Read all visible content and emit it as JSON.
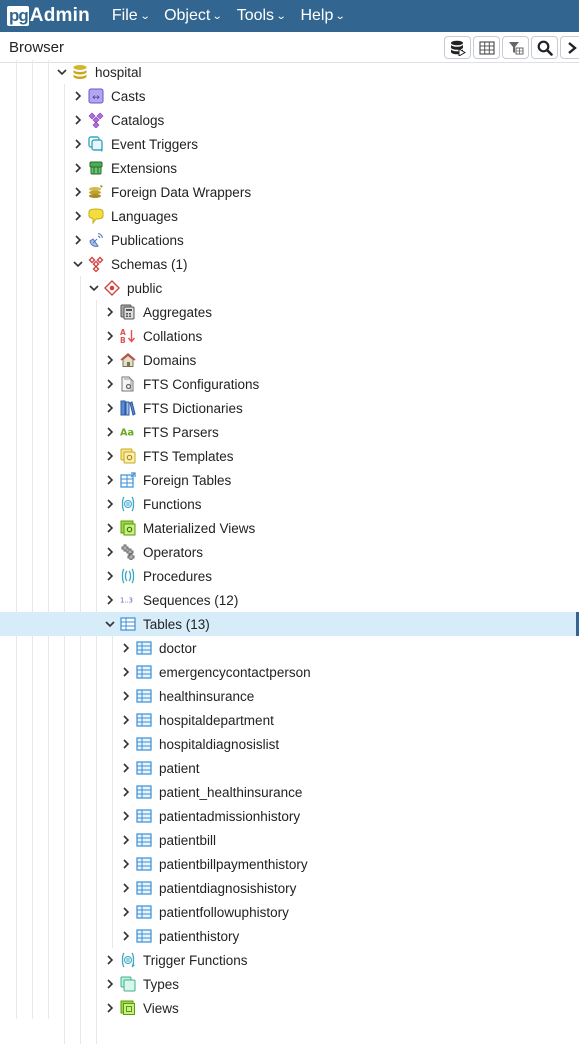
{
  "app": {
    "logo_pg": "pg",
    "logo_admin": "Admin",
    "menu": [
      {
        "label": "File"
      },
      {
        "label": "Object"
      },
      {
        "label": "Tools"
      },
      {
        "label": "Help"
      }
    ]
  },
  "browser": {
    "title": "Browser",
    "toolbar": [
      {
        "icon": "query-tool-icon"
      },
      {
        "icon": "view-data-icon"
      },
      {
        "icon": "filtered-rows-icon"
      },
      {
        "icon": "search-objects-icon"
      },
      {
        "icon": "psql-tool-icon"
      }
    ]
  },
  "tree": {
    "accent": "#326690",
    "selected_bg": "#d6ecf9",
    "rows": [
      {
        "label": "hospital",
        "level": 0,
        "expanded": true,
        "icon": "database-icon"
      },
      {
        "label": "Casts",
        "level": 1,
        "expanded": false,
        "icon": "casts-icon"
      },
      {
        "label": "Catalogs",
        "level": 1,
        "expanded": false,
        "icon": "catalogs-icon"
      },
      {
        "label": "Event Triggers",
        "level": 1,
        "expanded": false,
        "icon": "event-triggers-icon"
      },
      {
        "label": "Extensions",
        "level": 1,
        "expanded": false,
        "icon": "extensions-icon"
      },
      {
        "label": "Foreign Data Wrappers",
        "level": 1,
        "expanded": false,
        "icon": "foreign-data-wrappers-icon"
      },
      {
        "label": "Languages",
        "level": 1,
        "expanded": false,
        "icon": "languages-icon"
      },
      {
        "label": "Publications",
        "level": 1,
        "expanded": false,
        "icon": "publications-icon"
      },
      {
        "label": "Schemas (1)",
        "level": 1,
        "expanded": true,
        "icon": "schemas-icon"
      },
      {
        "label": "public",
        "level": 2,
        "expanded": true,
        "icon": "schema-icon"
      },
      {
        "label": "Aggregates",
        "level": 3,
        "expanded": false,
        "icon": "aggregates-icon"
      },
      {
        "label": "Collations",
        "level": 3,
        "expanded": false,
        "icon": "collations-icon"
      },
      {
        "label": "Domains",
        "level": 3,
        "expanded": false,
        "icon": "domains-icon"
      },
      {
        "label": "FTS Configurations",
        "level": 3,
        "expanded": false,
        "icon": "fts-configurations-icon"
      },
      {
        "label": "FTS Dictionaries",
        "level": 3,
        "expanded": false,
        "icon": "fts-dictionaries-icon"
      },
      {
        "label": "FTS Parsers",
        "level": 3,
        "expanded": false,
        "icon": "fts-parsers-icon"
      },
      {
        "label": "FTS Templates",
        "level": 3,
        "expanded": false,
        "icon": "fts-templates-icon"
      },
      {
        "label": "Foreign Tables",
        "level": 3,
        "expanded": false,
        "icon": "foreign-tables-icon"
      },
      {
        "label": "Functions",
        "level": 3,
        "expanded": false,
        "icon": "functions-icon"
      },
      {
        "label": "Materialized Views",
        "level": 3,
        "expanded": false,
        "icon": "materialized-views-icon"
      },
      {
        "label": "Operators",
        "level": 3,
        "expanded": false,
        "icon": "operators-icon"
      },
      {
        "label": "Procedures",
        "level": 3,
        "expanded": false,
        "icon": "procedures-icon"
      },
      {
        "label": "Sequences (12)",
        "level": 3,
        "expanded": false,
        "icon": "sequences-icon"
      },
      {
        "label": "Tables (13)",
        "level": 3,
        "expanded": true,
        "icon": "tables-icon",
        "selected": true
      },
      {
        "label": "doctor",
        "level": 4,
        "expanded": false,
        "icon": "table-icon"
      },
      {
        "label": "emergencycontactperson",
        "level": 4,
        "expanded": false,
        "icon": "table-icon"
      },
      {
        "label": "healthinsurance",
        "level": 4,
        "expanded": false,
        "icon": "table-icon"
      },
      {
        "label": "hospitaldepartment",
        "level": 4,
        "expanded": false,
        "icon": "table-icon"
      },
      {
        "label": "hospitaldiagnosislist",
        "level": 4,
        "expanded": false,
        "icon": "table-icon"
      },
      {
        "label": "patient",
        "level": 4,
        "expanded": false,
        "icon": "table-icon"
      },
      {
        "label": "patient_healthinsurance",
        "level": 4,
        "expanded": false,
        "icon": "table-icon"
      },
      {
        "label": "patientadmissionhistory",
        "level": 4,
        "expanded": false,
        "icon": "table-icon"
      },
      {
        "label": "patientbill",
        "level": 4,
        "expanded": false,
        "icon": "table-icon"
      },
      {
        "label": "patientbillpaymenthistory",
        "level": 4,
        "expanded": false,
        "icon": "table-icon"
      },
      {
        "label": "patientdiagnosishistory",
        "level": 4,
        "expanded": false,
        "icon": "table-icon"
      },
      {
        "label": "patientfollowuphistory",
        "level": 4,
        "expanded": false,
        "icon": "table-icon"
      },
      {
        "label": "patienthistory",
        "level": 4,
        "expanded": false,
        "icon": "table-icon"
      },
      {
        "label": "Trigger Functions",
        "level": 3,
        "expanded": false,
        "icon": "trigger-functions-icon"
      },
      {
        "label": "Types",
        "level": 3,
        "expanded": false,
        "icon": "types-icon"
      },
      {
        "label": "Views",
        "level": 3,
        "expanded": false,
        "icon": "views-icon"
      }
    ]
  }
}
